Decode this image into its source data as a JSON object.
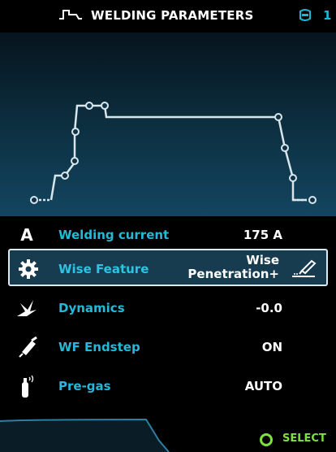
{
  "header": {
    "title": "WELDING PARAMETERS",
    "channel": "1"
  },
  "params": [
    {
      "label": "Welding current",
      "value": "175 A",
      "icon": "ampere-icon"
    },
    {
      "label": "Wise Feature",
      "value_line1": "Wise",
      "value_line2": "Penetration+",
      "icon": "gear-icon",
      "selected": true
    },
    {
      "label": "Dynamics",
      "value": "-0.0",
      "icon": "dynamics-icon"
    },
    {
      "label": "WF Endstep",
      "value": "ON",
      "icon": "welding-torch-icon"
    },
    {
      "label": "Pre-gas",
      "value": "AUTO",
      "icon": "gas-bottle-icon"
    }
  ],
  "footer": {
    "select_label": "SELECT"
  },
  "colors": {
    "accent": "#27b8d8",
    "select": "#7ee23c",
    "selected_row": "#173b4f"
  }
}
